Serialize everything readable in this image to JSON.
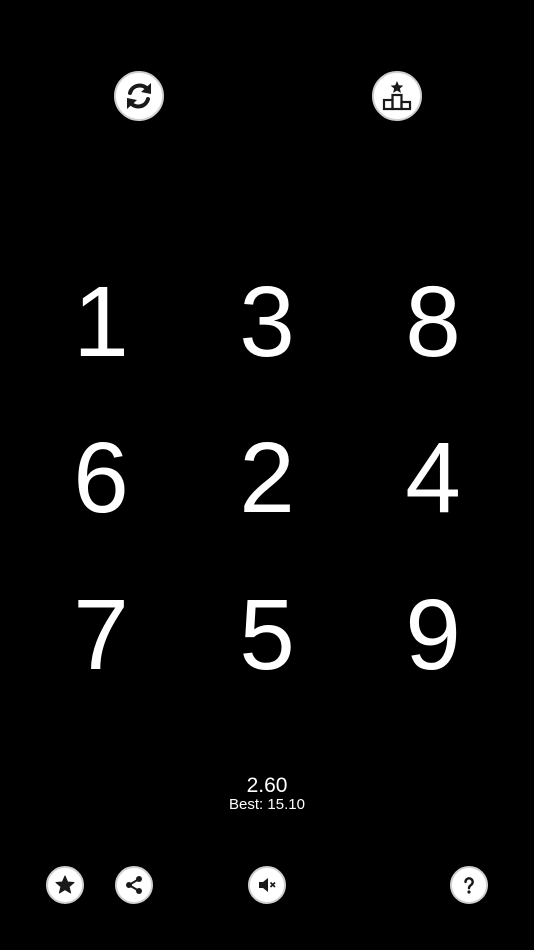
{
  "top_buttons": {
    "restart_icon": "refresh-icon",
    "leaderboard_icon": "podium-star-icon"
  },
  "grid": {
    "numbers": [
      "1",
      "3",
      "8",
      "6",
      "2",
      "4",
      "7",
      "5",
      "9"
    ]
  },
  "timer": {
    "current": "2.60",
    "best": "Best: 15.10"
  },
  "bottom_buttons": {
    "rate_icon": "star-icon",
    "share_icon": "share-icon",
    "sound_icon": "speaker-muted-icon",
    "help_icon": "question-mark-icon"
  },
  "colors": {
    "background": "#000000",
    "foreground": "#ffffff",
    "button_fill": "#ffffff",
    "icon": "#1a1a1a"
  }
}
